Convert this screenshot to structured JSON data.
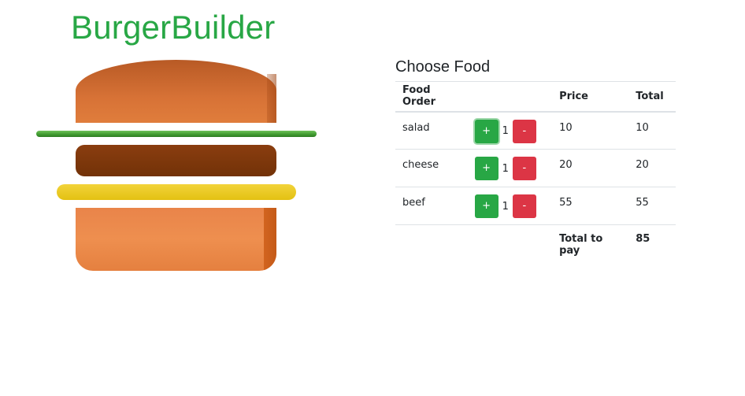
{
  "app": {
    "title": "BurgerBuilder"
  },
  "colors": {
    "title_green": "#28a745",
    "plus_button": "#28a745",
    "minus_button": "#dc3545",
    "bun": "#e07d3c",
    "lettuce": "#3f9a2f",
    "patty": "#7a3509",
    "cheese": "#e8c61a"
  },
  "burger": {
    "layers": [
      "bun-top",
      "lettuce",
      "patty",
      "cheese",
      "bun-bottom"
    ]
  },
  "order_panel": {
    "title": "Choose Food",
    "columns": {
      "food": "Food Order",
      "controls": "",
      "price": "Price",
      "total": "Total"
    },
    "plus_label": "+",
    "minus_label": "-",
    "items": [
      {
        "name": "salad",
        "quantity": "1",
        "price": "10",
        "total": "10"
      },
      {
        "name": "cheese",
        "quantity": "1",
        "price": "20",
        "total": "20"
      },
      {
        "name": "beef",
        "quantity": "1",
        "price": "55",
        "total": "55"
      }
    ],
    "total_label": "Total to pay",
    "total_value": "85"
  }
}
